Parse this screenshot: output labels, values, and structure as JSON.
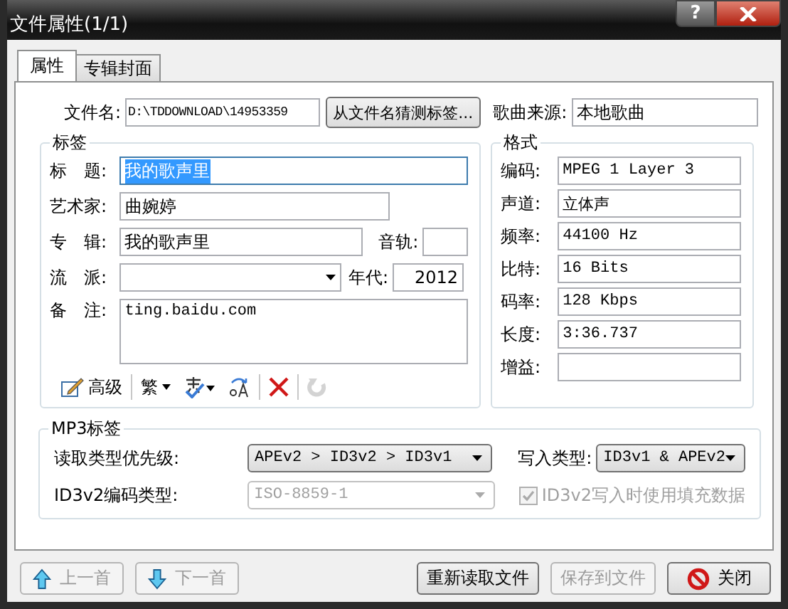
{
  "window": {
    "title": "文件属性(1/1)",
    "help_button": "?"
  },
  "tabs": [
    {
      "label": "属性",
      "selected": true
    },
    {
      "label": "专辑封面",
      "selected": false
    }
  ],
  "file": {
    "label": "文件名:",
    "value": "D:\\TDDOWNLOAD\\14953359",
    "guess_button": "从文件名猜测标签...",
    "source_label": "歌曲来源:",
    "source_value": "本地歌曲"
  },
  "tag_group": {
    "title": "标签",
    "title_field": {
      "label": "标　题:",
      "value": "我的歌声里",
      "text_selected": true
    },
    "artist": {
      "label": "艺术家:",
      "value": "曲婉婷"
    },
    "album": {
      "label": "专　辑:",
      "value": "我的歌声里"
    },
    "track": {
      "label": "音轨:"
    },
    "genre": {
      "label": "流　派:"
    },
    "year": {
      "label": "年代:",
      "value": "2012"
    },
    "comment": {
      "label": "备　注:",
      "value": "ting.baidu.com"
    },
    "toolbar": [
      {
        "kind": "advanced",
        "label": "高级",
        "disabled": false
      },
      {
        "kind": "separator"
      },
      {
        "kind": "traditional",
        "label": "繁",
        "disabled": false
      },
      {
        "kind": "font",
        "disabled": false
      },
      {
        "kind": "case",
        "disabled": false
      },
      {
        "kind": "separator"
      },
      {
        "kind": "delete",
        "disabled": false
      },
      {
        "kind": "separator"
      },
      {
        "kind": "undo",
        "disabled": true
      }
    ]
  },
  "format_group": {
    "title": "格式",
    "rows": [
      {
        "label": "编码:",
        "value": "MPEG 1 Layer 3"
      },
      {
        "label": "声道:",
        "value": "立体声"
      },
      {
        "label": "频率:",
        "value": "44100 Hz"
      },
      {
        "label": "比特:",
        "value": "16 Bits"
      },
      {
        "label": "码率:",
        "value": "128 Kbps"
      },
      {
        "label": "长度:",
        "value": "3:36.737"
      },
      {
        "label": "增益:",
        "value": ""
      }
    ]
  },
  "mp3_group": {
    "title": "MP3标签",
    "read_priority": {
      "label": "读取类型优先级:",
      "value": "APEv2 > ID3v2 > ID3v1",
      "disabled": false
    },
    "write_type": {
      "label": "写入类型:",
      "value": "ID3v1 & APEv2",
      "disabled": false
    },
    "encoding": {
      "label": "ID3v2编码类型:",
      "value": "ISO-8859-1",
      "disabled": true
    },
    "padding": {
      "label": "ID3v2写入时使用填充数据",
      "checked": true,
      "disabled": true
    }
  },
  "buttons": [
    {
      "kind": "prev",
      "label": "上一首",
      "disabled": true
    },
    {
      "kind": "next",
      "label": "下一首",
      "disabled": true
    },
    {
      "kind": "reload",
      "label": "重新读取文件",
      "disabled": false
    },
    {
      "kind": "save",
      "label": "保存到文件",
      "disabled": true
    },
    {
      "kind": "close",
      "label": "关闭",
      "disabled": false
    }
  ]
}
